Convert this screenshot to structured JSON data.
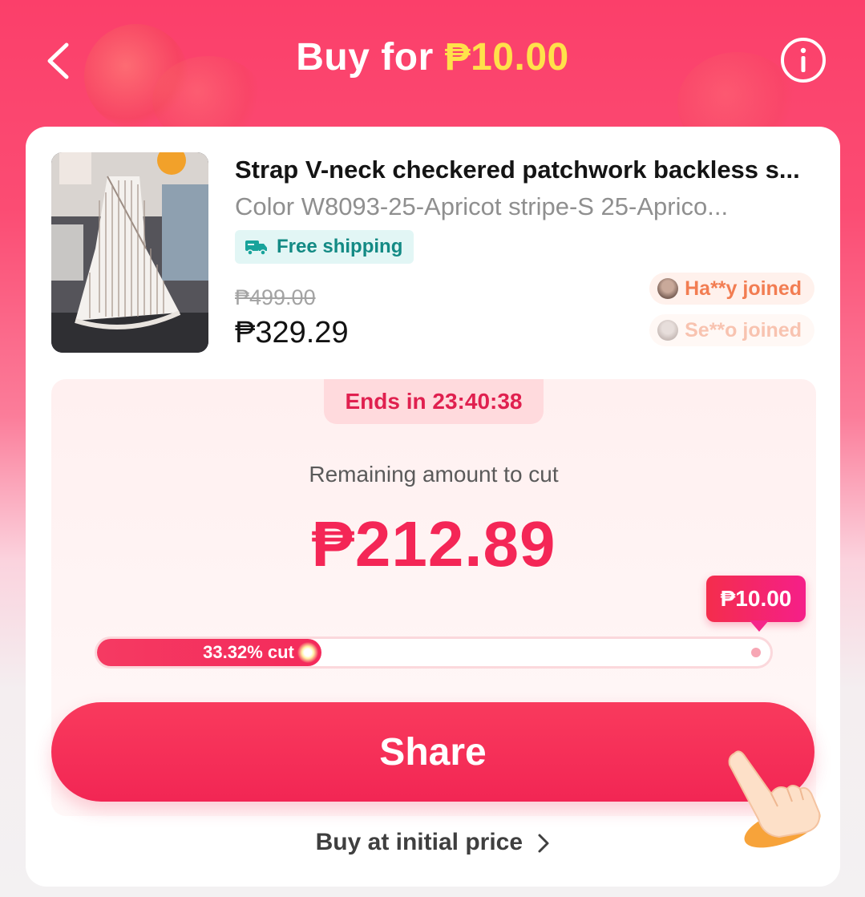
{
  "header": {
    "title_prefix": "Buy for",
    "title_price": "₱10.00",
    "back_icon": "chevron-left-icon",
    "info_icon": "info-icon"
  },
  "product": {
    "image": "checkered-sleeveless-dress-photo",
    "title": "Strap V-neck checkered patchwork backless s...",
    "variant": "Color W8093-25-Apricot stripe-S 25-Aprico...",
    "shipping_badge": "Free shipping",
    "shipping_icon": "truck-icon",
    "original_price": "₱499.00",
    "current_price": "₱329.29",
    "joined": [
      {
        "label": "Ha**y joined"
      },
      {
        "label": "Se**o joined"
      }
    ]
  },
  "cut_panel": {
    "timer_label": "Ends in 23:40:38",
    "remaining_label": "Remaining amount to cut",
    "remaining_amount": "₱212.89",
    "target_price": "₱10.00",
    "progress_percent": 33.32,
    "progress_label": "33.32% cut"
  },
  "actions": {
    "share_label": "Share",
    "buy_initial_label": "Buy at initial price"
  },
  "colors": {
    "accent": "#f42656",
    "header_bg": "#fb3f6a",
    "price_yellow": "#ffe14a",
    "shipping_teal": "#138a84"
  }
}
